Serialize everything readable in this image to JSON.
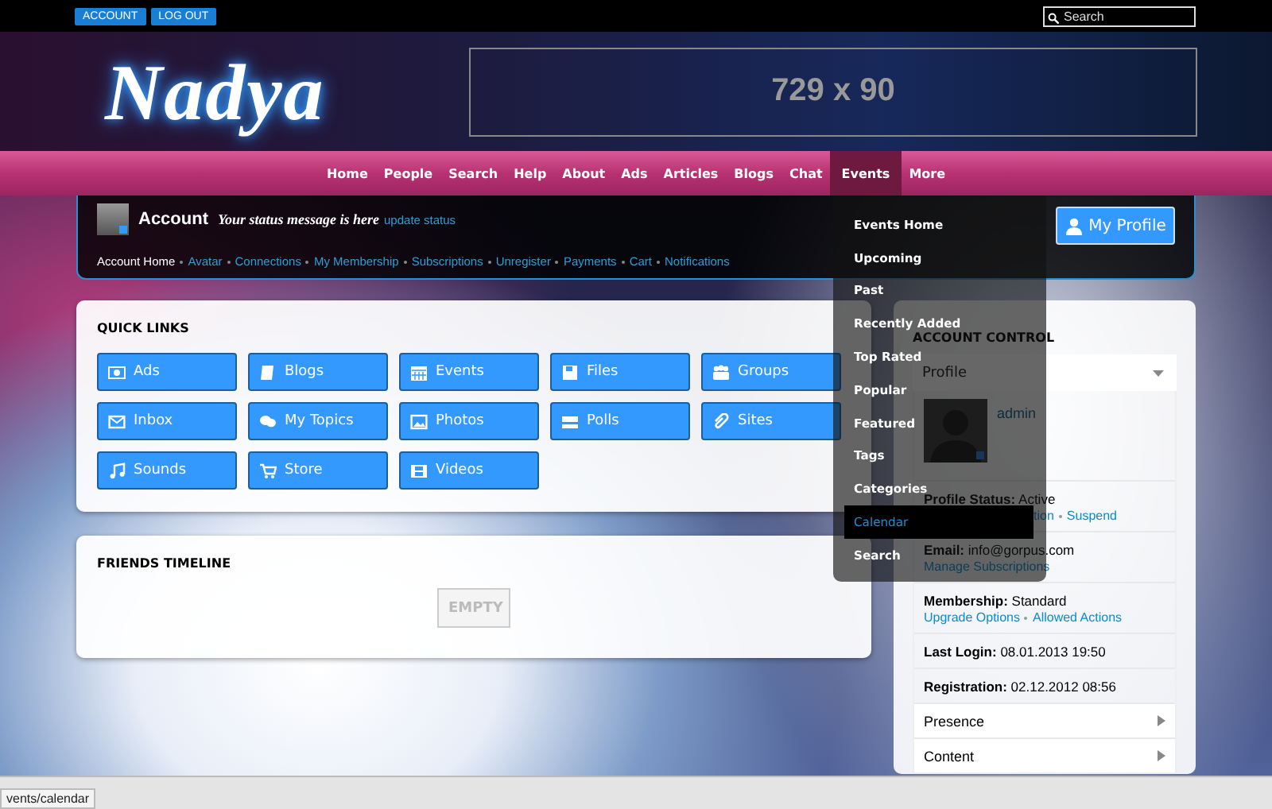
{
  "top_bar": {
    "buttons": [
      "ACCOUNT",
      "LOG OUT"
    ],
    "search": {
      "placeholder": "Search"
    }
  },
  "header": {
    "logo": "Nadya",
    "banner": "729 x 90"
  },
  "nav": [
    {
      "label": "Home",
      "selected": false
    },
    {
      "label": "People",
      "selected": false
    },
    {
      "label": "Search",
      "selected": false
    },
    {
      "label": "Help",
      "selected": false
    },
    {
      "label": "About",
      "selected": false
    },
    {
      "label": "Ads",
      "selected": false
    },
    {
      "label": "Articles",
      "selected": false
    },
    {
      "label": "Blogs",
      "selected": false
    },
    {
      "label": "Chat",
      "selected": false
    },
    {
      "label": "Events",
      "selected": true
    },
    {
      "label": "More",
      "selected": false
    }
  ],
  "account": {
    "title": "Account",
    "status": "Your status message is here",
    "status_link": "update status",
    "profile_button": "My Profile",
    "links": [
      {
        "label": "Account Home",
        "kind": "current"
      },
      {
        "label": "Avatar",
        "kind": "link"
      },
      {
        "label": "Connections",
        "kind": "link"
      },
      {
        "label": "My Membership",
        "kind": "link"
      },
      {
        "label": "Subscriptions",
        "kind": "link"
      },
      {
        "label": "Unregister",
        "kind": "link"
      },
      {
        "label": "Payments",
        "kind": "link"
      },
      {
        "label": "Cart",
        "kind": "link"
      },
      {
        "label": "Notifications",
        "kind": "link"
      }
    ]
  },
  "quick_links": {
    "title": "QUICK LINKS",
    "buttons": [
      "Ads",
      "Blogs",
      "Events",
      "Files",
      "Groups",
      "Inbox",
      "My Topics",
      "Photos",
      "Polls",
      "Sites",
      "Sounds",
      "Store",
      "Videos"
    ]
  },
  "friends_timeline": {
    "title": "FRIENDS TIMELINE",
    "empty": "EMPTY"
  },
  "account_control": {
    "title": "ACCOUNT CONTROL",
    "select": "Profile",
    "user": "admin",
    "rows": [
      {
        "kind": "field",
        "label": "Profile Status:",
        "value": "Active",
        "links": [
          "tion",
          "Suspend"
        ]
      },
      {
        "kind": "field",
        "label": "Email:",
        "value": "info@gorpus.com",
        "links": [
          "Manage Subscriptions"
        ]
      },
      {
        "kind": "field",
        "label": "Membership:",
        "value": "Standard",
        "links": [
          "Upgrade Options",
          "Allowed Actions"
        ]
      },
      {
        "kind": "field",
        "label": "Last Login:",
        "value": "08.01.2013 19:50"
      },
      {
        "kind": "field",
        "label": "Registration:",
        "value": "02.12.2012 08:56"
      },
      {
        "kind": "expand",
        "label": "Presence"
      },
      {
        "kind": "expand",
        "label": "Content"
      }
    ]
  },
  "events_menu": [
    {
      "label": "Events Home",
      "selected": false
    },
    {
      "label": "Upcoming",
      "selected": false
    },
    {
      "label": "Past",
      "selected": false
    },
    {
      "label": "Recently Added",
      "selected": false
    },
    {
      "label": "Top Rated",
      "selected": false
    },
    {
      "label": "Popular",
      "selected": false
    },
    {
      "label": "Featured",
      "selected": false
    },
    {
      "label": "Tags",
      "selected": false
    },
    {
      "label": "Categories",
      "selected": false
    },
    {
      "label": "Calendar",
      "selected": true
    },
    {
      "label": "Search",
      "selected": false
    }
  ],
  "status_url": "vents/calendar"
}
